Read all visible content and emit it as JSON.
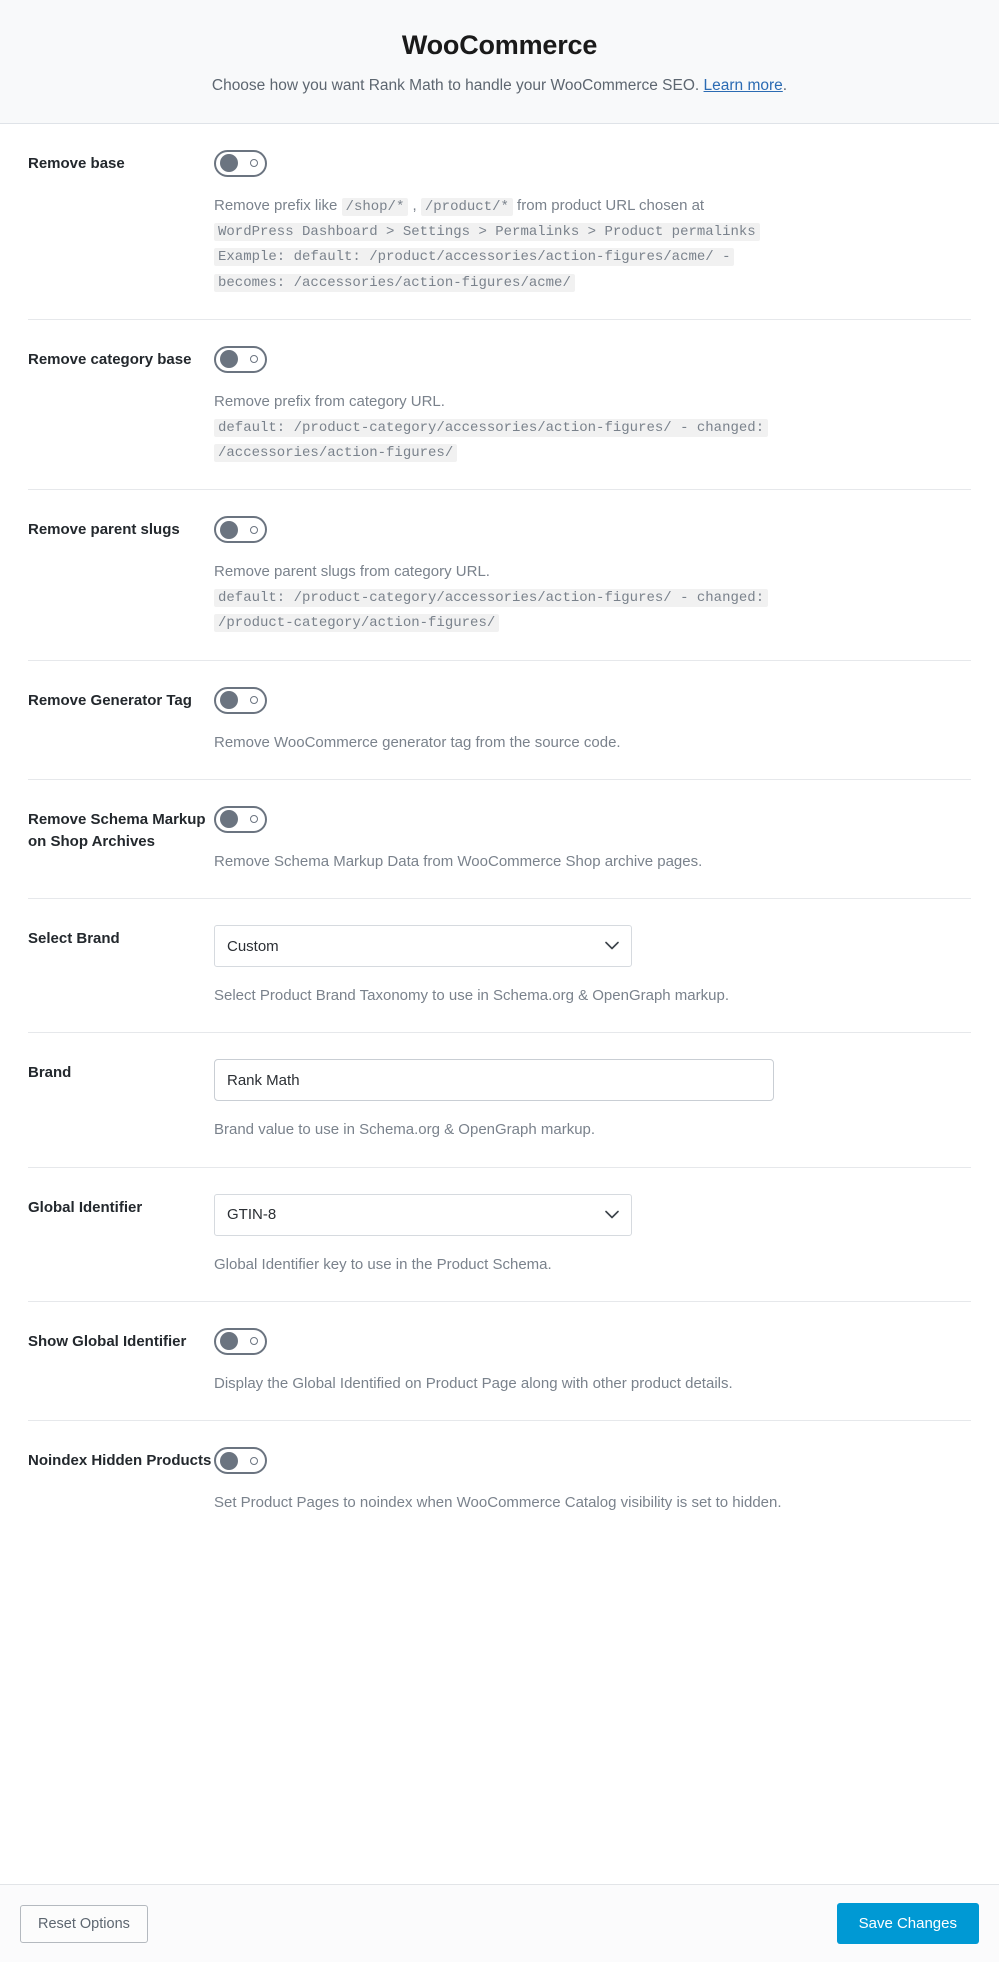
{
  "header": {
    "title": "WooCommerce",
    "subtitle_before": "Choose how you want Rank Math to handle your WooCommerce SEO. ",
    "learn_more_label": "Learn more",
    "subtitle_after": "."
  },
  "colors": {
    "save_button": "#0099d4",
    "link": "#2b6bb3",
    "toggle_border": "#6b7480",
    "header_bg": "#f8f9fa"
  },
  "fields": [
    {
      "label": "Remove base",
      "type": "toggle",
      "state": "off",
      "desc_parts": [
        {
          "t": "Remove prefix like ",
          "code": false
        },
        {
          "t": "/shop/*",
          "code": true
        },
        {
          "t": " , ",
          "code": false
        },
        {
          "t": "/product/*",
          "code": true
        },
        {
          "t": " from product URL chosen at",
          "code": false
        }
      ],
      "code_lines": [
        "WordPress Dashboard > Settings > Permalinks > Product permalinks",
        "Example: default: /product/accessories/action-figures/acme/ -",
        "becomes: /accessories/action-figures/acme/"
      ]
    },
    {
      "label": "Remove category base",
      "type": "toggle",
      "state": "off",
      "desc_parts": [
        {
          "t": "Remove prefix from category URL.",
          "code": false
        }
      ],
      "code_lines": [
        "default: /product-category/accessories/action-figures/ - changed:",
        "/accessories/action-figures/"
      ]
    },
    {
      "label": "Remove parent slugs",
      "type": "toggle",
      "state": "off",
      "desc_parts": [
        {
          "t": "Remove parent slugs from category URL.",
          "code": false
        }
      ],
      "code_lines": [
        "default: /product-category/accessories/action-figures/ - changed:",
        "/product-category/action-figures/"
      ]
    },
    {
      "label": "Remove Generator Tag",
      "type": "toggle",
      "state": "off",
      "desc_parts": [
        {
          "t": "Remove WooCommerce generator tag from the source code.",
          "code": false
        }
      ],
      "code_lines": []
    },
    {
      "label": "Remove Schema Markup on Shop Archives",
      "type": "toggle",
      "state": "off",
      "desc_parts": [
        {
          "t": "Remove Schema Markup Data from WooCommerce Shop archive pages.",
          "code": false
        }
      ],
      "code_lines": []
    },
    {
      "label": "Select Brand",
      "type": "select",
      "value": "Custom",
      "desc_parts": [
        {
          "t": "Select Product Brand Taxonomy to use in Schema.org & OpenGraph markup.",
          "code": false
        }
      ],
      "code_lines": []
    },
    {
      "label": "Brand",
      "type": "text",
      "value": "Rank Math",
      "placeholder": "",
      "desc_parts": [
        {
          "t": "Brand value to use in Schema.org & OpenGraph markup.",
          "code": false
        }
      ],
      "code_lines": []
    },
    {
      "label": "Global Identifier",
      "type": "select",
      "value": "GTIN-8",
      "desc_parts": [
        {
          "t": "Global Identifier key to use in the Product Schema.",
          "code": false
        }
      ],
      "code_lines": []
    },
    {
      "label": "Show Global Identifier",
      "type": "toggle",
      "state": "off",
      "desc_parts": [
        {
          "t": "Display the Global Identified on Product Page along with other product details.",
          "code": false
        }
      ],
      "code_lines": []
    },
    {
      "label": "Noindex Hidden Products",
      "type": "toggle",
      "state": "off",
      "desc_parts": [
        {
          "t": "Set Product Pages to noindex when WooCommerce Catalog visibility is set to hidden.",
          "code": false
        }
      ],
      "code_lines": []
    }
  ],
  "footer": {
    "reset_label": "Reset Options",
    "save_label": "Save Changes"
  }
}
